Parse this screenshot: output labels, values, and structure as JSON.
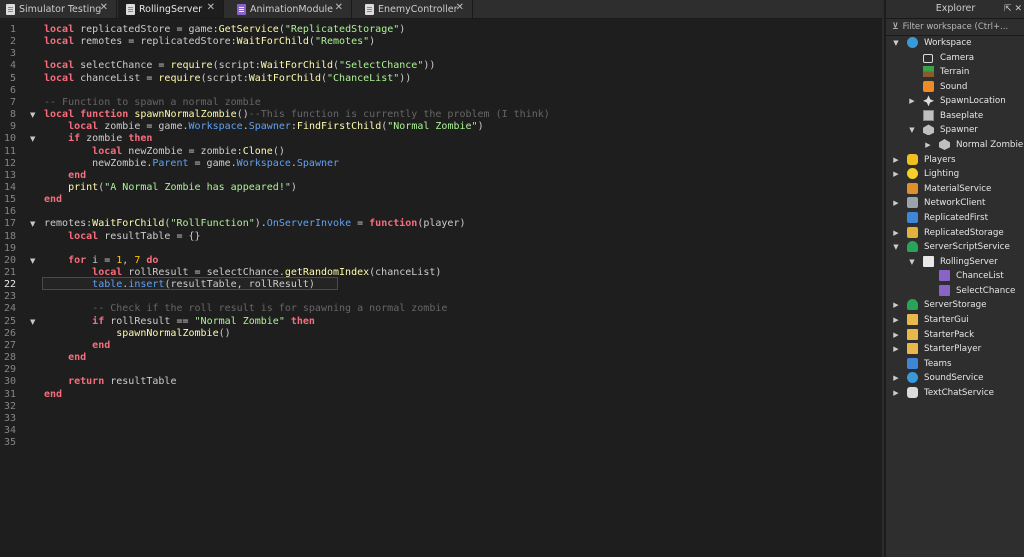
{
  "tabs": [
    {
      "label": "Simulator Testing",
      "icon": "script-icon",
      "close": "✕"
    },
    {
      "label": "RollingServer",
      "icon": "script-icon",
      "close": "✕"
    },
    {
      "label": "AnimationModule",
      "icon": "module-script-icon",
      "close": "✕"
    },
    {
      "label": "EnemyController",
      "icon": "script-icon",
      "close": "✕"
    }
  ],
  "editor": {
    "line_numbers": [
      "1",
      "2",
      "3",
      "4",
      "5",
      "6",
      "7",
      "8",
      "9",
      "10",
      "11",
      "12",
      "13",
      "14",
      "15",
      "16",
      "17",
      "18",
      "19",
      "20",
      "21",
      "22",
      "23",
      "24",
      "25",
      "26",
      "27",
      "28",
      "29",
      "30",
      "31",
      "32",
      "33",
      "34",
      "35"
    ],
    "current_line": "22",
    "fold_arrow": "▼"
  },
  "explorer": {
    "title": "Explorer",
    "filter_placeholder": "Filter workspace (Ctrl+...",
    "header_icons": "⇱ ✕",
    "items": [
      {
        "label": "Workspace",
        "icon": "workspace-icon",
        "expand": "▼"
      },
      {
        "label": "Camera",
        "icon": "camera-icon"
      },
      {
        "label": "Terrain",
        "icon": "terrain-icon"
      },
      {
        "label": "Sound",
        "icon": "sound-icon"
      },
      {
        "label": "SpawnLocation",
        "icon": "spawn-location-icon",
        "expand": "▶"
      },
      {
        "label": "Baseplate",
        "icon": "part-icon"
      },
      {
        "label": "Spawner",
        "icon": "model-icon",
        "expand": "▼"
      },
      {
        "label": "Normal Zombie",
        "icon": "model-icon",
        "expand": "▶"
      },
      {
        "label": "Players",
        "icon": "players-icon",
        "expand": "▶"
      },
      {
        "label": "Lighting",
        "icon": "lighting-icon",
        "expand": "▶"
      },
      {
        "label": "MaterialService",
        "icon": "material-service-icon"
      },
      {
        "label": "NetworkClient",
        "icon": "network-client-icon",
        "expand": "▶"
      },
      {
        "label": "ReplicatedFirst",
        "icon": "replicated-first-icon"
      },
      {
        "label": "ReplicatedStorage",
        "icon": "replicated-storage-icon",
        "expand": "▶"
      },
      {
        "label": "ServerScriptService",
        "icon": "server-script-service-icon",
        "expand": "▼"
      },
      {
        "label": "RollingServer",
        "icon": "script-icon",
        "expand": "▼"
      },
      {
        "label": "ChanceList",
        "icon": "module-script-icon"
      },
      {
        "label": "SelectChance",
        "icon": "module-script-icon"
      },
      {
        "label": "ServerStorage",
        "icon": "server-storage-icon",
        "expand": "▶"
      },
      {
        "label": "StarterGui",
        "icon": "starter-gui-icon",
        "expand": "▶"
      },
      {
        "label": "StarterPack",
        "icon": "starter-pack-icon",
        "expand": "▶"
      },
      {
        "label": "StarterPlayer",
        "icon": "starter-player-icon",
        "expand": "▶"
      },
      {
        "label": "Teams",
        "icon": "teams-icon"
      },
      {
        "label": "SoundService",
        "icon": "sound-service-icon",
        "expand": "▶"
      },
      {
        "label": "TextChatService",
        "icon": "text-chat-service-icon",
        "expand": "▶"
      }
    ]
  },
  "code_lines": [
    [
      {
        "t": "local",
        "c": "kw"
      },
      {
        "t": " replicatedStore = game:"
      },
      {
        "t": "GetService",
        "c": "fn"
      },
      {
        "t": "("
      },
      {
        "t": "\"ReplicatedStorage\"",
        "c": "str"
      },
      {
        "t": ")"
      }
    ],
    [
      {
        "t": "local",
        "c": "kw"
      },
      {
        "t": " remotes = replicatedStore:"
      },
      {
        "t": "WaitForChild",
        "c": "fn"
      },
      {
        "t": "("
      },
      {
        "t": "\"Remotes\"",
        "c": "str"
      },
      {
        "t": ")"
      }
    ],
    [],
    [
      {
        "t": "local",
        "c": "kw"
      },
      {
        "t": " selectChance = "
      },
      {
        "t": "require",
        "c": "fn"
      },
      {
        "t": "(script:"
      },
      {
        "t": "WaitForChild",
        "c": "fn"
      },
      {
        "t": "("
      },
      {
        "t": "\"SelectChance\"",
        "c": "str"
      },
      {
        "t": "))"
      }
    ],
    [
      {
        "t": "local",
        "c": "kw"
      },
      {
        "t": " chanceList = "
      },
      {
        "t": "require",
        "c": "fn"
      },
      {
        "t": "(script:"
      },
      {
        "t": "WaitForChild",
        "c": "fn"
      },
      {
        "t": "("
      },
      {
        "t": "\"ChanceList\"",
        "c": "str"
      },
      {
        "t": "))"
      }
    ],
    [],
    [
      {
        "t": "-- Function to spawn a normal zombie",
        "c": "cm"
      }
    ],
    [
      {
        "t": "local",
        "c": "kw"
      },
      {
        "t": " "
      },
      {
        "t": "function",
        "c": "kw"
      },
      {
        "t": " "
      },
      {
        "t": "spawnNormalZombie",
        "c": "fn"
      },
      {
        "t": "()"
      },
      {
        "t": "--This function is currently the problem (I think)",
        "c": "cm"
      }
    ],
    [
      {
        "t": "    "
      },
      {
        "t": "local",
        "c": "kw"
      },
      {
        "t": " zombie = game."
      },
      {
        "t": "Workspace",
        "c": "prop"
      },
      {
        "t": "."
      },
      {
        "t": "Spawner",
        "c": "prop"
      },
      {
        "t": ":"
      },
      {
        "t": "FindFirstChild",
        "c": "fn"
      },
      {
        "t": "("
      },
      {
        "t": "\"Normal Zombie\"",
        "c": "str"
      },
      {
        "t": ")"
      }
    ],
    [
      {
        "t": "    "
      },
      {
        "t": "if",
        "c": "kw"
      },
      {
        "t": " zombie "
      },
      {
        "t": "then",
        "c": "kw"
      }
    ],
    [
      {
        "t": "        "
      },
      {
        "t": "local",
        "c": "kw"
      },
      {
        "t": " newZombie = zombie:"
      },
      {
        "t": "Clone",
        "c": "fn"
      },
      {
        "t": "()"
      }
    ],
    [
      {
        "t": "        newZombie."
      },
      {
        "t": "Parent",
        "c": "prop"
      },
      {
        "t": " = game."
      },
      {
        "t": "Workspace",
        "c": "prop"
      },
      {
        "t": "."
      },
      {
        "t": "Spawner",
        "c": "prop"
      }
    ],
    [
      {
        "t": "    "
      },
      {
        "t": "end",
        "c": "kw"
      }
    ],
    [
      {
        "t": "    "
      },
      {
        "t": "print",
        "c": "fn"
      },
      {
        "t": "("
      },
      {
        "t": "\"A Normal Zombie has appeared!\"",
        "c": "str"
      },
      {
        "t": ")"
      }
    ],
    [
      {
        "t": "end",
        "c": "kw"
      }
    ],
    [],
    [
      {
        "t": "remotes:"
      },
      {
        "t": "WaitForChild",
        "c": "fn"
      },
      {
        "t": "("
      },
      {
        "t": "\"RollFunction\"",
        "c": "str"
      },
      {
        "t": ")."
      },
      {
        "t": "OnServerInvoke",
        "c": "prop"
      },
      {
        "t": " = "
      },
      {
        "t": "function",
        "c": "kw"
      },
      {
        "t": "(player)"
      }
    ],
    [
      {
        "t": "    "
      },
      {
        "t": "local",
        "c": "kw"
      },
      {
        "t": " resultTable = {}"
      }
    ],
    [],
    [
      {
        "t": "    "
      },
      {
        "t": "for",
        "c": "kw"
      },
      {
        "t": " i = "
      },
      {
        "t": "1",
        "c": "num"
      },
      {
        "t": ", "
      },
      {
        "t": "7",
        "c": "num"
      },
      {
        "t": " "
      },
      {
        "t": "do",
        "c": "kw"
      }
    ],
    [
      {
        "t": "        "
      },
      {
        "t": "local",
        "c": "kw"
      },
      {
        "t": " rollResult = selectChance."
      },
      {
        "t": "getRandomIndex",
        "c": "fn"
      },
      {
        "t": "(chanceList)"
      }
    ],
    [
      {
        "t": "        "
      },
      {
        "t": "table",
        "c": "prop"
      },
      {
        "t": "."
      },
      {
        "t": "insert",
        "c": "prop"
      },
      {
        "t": "(resultTable, rollResult)"
      }
    ],
    [],
    [
      {
        "t": "        "
      },
      {
        "t": "-- Check if the roll result is for spawning a normal zombie",
        "c": "cm"
      }
    ],
    [
      {
        "t": "        "
      },
      {
        "t": "if",
        "c": "kw"
      },
      {
        "t": " rollResult == "
      },
      {
        "t": "\"Normal Zombie\"",
        "c": "str"
      },
      {
        "t": " "
      },
      {
        "t": "then",
        "c": "kw"
      }
    ],
    [
      {
        "t": "            "
      },
      {
        "t": "spawnNormalZombie",
        "c": "fn"
      },
      {
        "t": "()"
      }
    ],
    [
      {
        "t": "        "
      },
      {
        "t": "end",
        "c": "kw"
      }
    ],
    [
      {
        "t": "    "
      },
      {
        "t": "end",
        "c": "kw"
      }
    ],
    [],
    [
      {
        "t": "    "
      },
      {
        "t": "return",
        "c": "kw"
      },
      {
        "t": " resultTable"
      }
    ],
    [
      {
        "t": "end",
        "c": "kw"
      }
    ],
    [],
    [],
    [],
    []
  ]
}
